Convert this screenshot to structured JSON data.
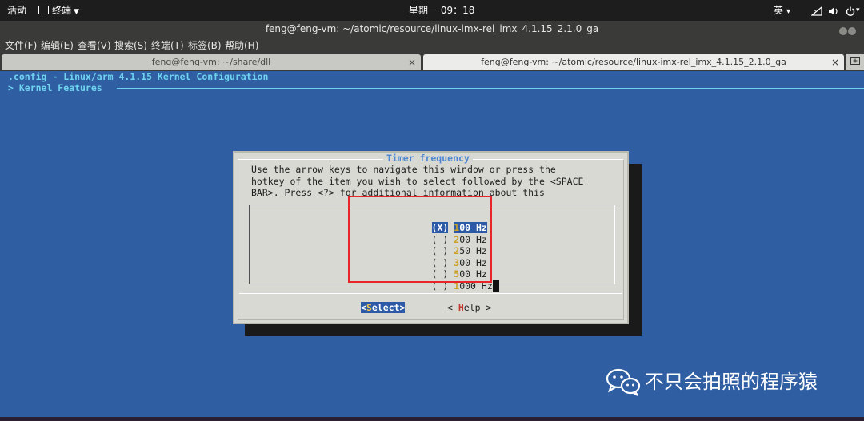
{
  "topbar": {
    "activities": "活动",
    "app_menu": "终端",
    "clock": "星期一 09：18",
    "input_method": "英",
    "ime_arrow": "▾"
  },
  "window": {
    "title": "feng@feng-vm: ~/atomic/resource/linux-imx-rel_imx_4.1.15_2.1.0_ga"
  },
  "menubar": [
    "文件(F)",
    "编辑(E)",
    "查看(V)",
    "搜索(S)",
    "终端(T)",
    "标签(B)",
    "帮助(H)"
  ],
  "tabs": [
    {
      "label": "feng@feng-vm: ~/share/dll",
      "close": "×"
    },
    {
      "label": "feng@feng-vm: ~/atomic/resource/linux-imx-rel_imx_4.1.15_2.1.0_ga",
      "close": "×"
    }
  ],
  "terminal": {
    "line1": ".config - Linux/arm 4.1.15 Kernel Configuration",
    "line2": "> Kernel Features"
  },
  "dialog": {
    "title": "Timer frequency",
    "help_lines": [
      "Use the arrow keys to navigate this window or press the",
      "hotkey of the item you wish to select followed by the <SPACE",
      "BAR>. Press <?> for additional information about this"
    ],
    "options": [
      {
        "mark": "(X)",
        "hotkey": "1",
        "rest": "00 Hz",
        "selected": true
      },
      {
        "mark": "( )",
        "hotkey": "2",
        "rest": "00 Hz"
      },
      {
        "mark": "( )",
        "hotkey": "2",
        "rest": "50 Hz"
      },
      {
        "mark": "( )",
        "hotkey": "3",
        "rest": "00 Hz"
      },
      {
        "mark": "( )",
        "hotkey": "5",
        "rest": "00 Hz"
      },
      {
        "mark": "( )",
        "hotkey": "1",
        "rest": "000 Hz"
      }
    ],
    "select_button": {
      "open": "<",
      "hotkey": "S",
      "rest": "elect>"
    },
    "help_button": {
      "open": "< ",
      "hotkey": "H",
      "rest": "elp >"
    }
  },
  "watermark": {
    "text": "不只会拍照的程序猿"
  },
  "colors": {
    "terminal_bg": "#2f5ea3",
    "title_accent": "#6fd3ee",
    "selection": "#2c5aa6",
    "annotation_red": "#e8262a"
  }
}
